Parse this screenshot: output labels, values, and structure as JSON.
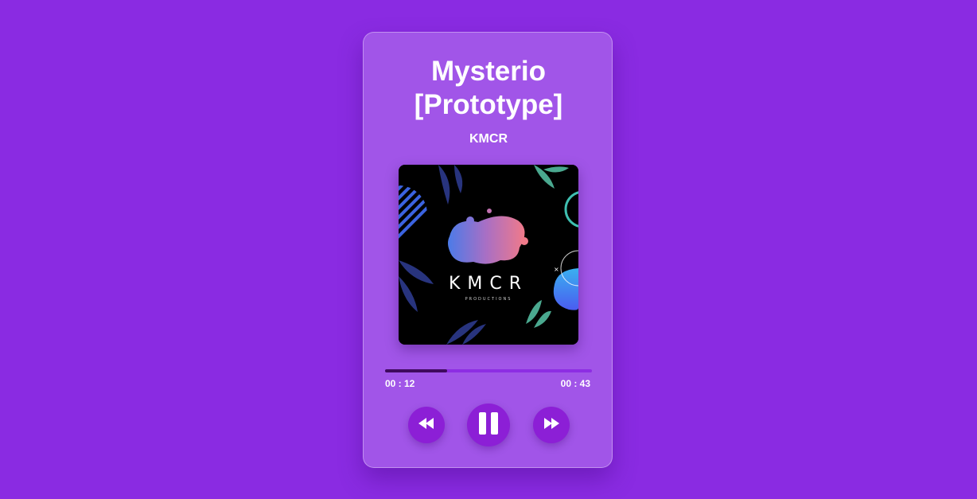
{
  "song": {
    "title": "Mysterio [Prototype]",
    "artist": "KMCR"
  },
  "cover": {
    "brand_text": "KMCR",
    "sub_text": "PRODUCTIONS"
  },
  "progress": {
    "current_time": "00 : 12",
    "total_time": "00 : 43",
    "fraction": 0.3
  },
  "controls": {
    "rewind_icon": "rewind-icon",
    "pause_icon": "pause-icon",
    "forward_icon": "fast-forward-icon"
  },
  "colors": {
    "background": "#8a2be2",
    "card": "#a155e8",
    "button": "#8c1fd6",
    "progress_fill": "#3f0a5e"
  }
}
